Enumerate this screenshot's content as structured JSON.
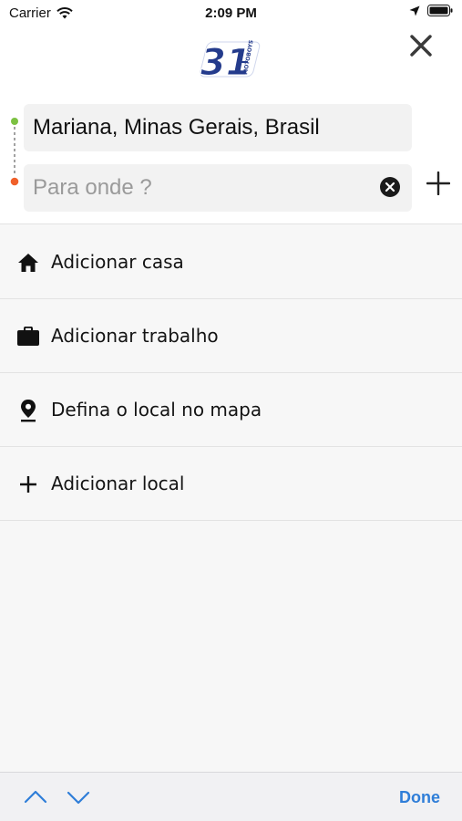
{
  "status_bar": {
    "carrier": "Carrier",
    "time": "2:09 PM"
  },
  "header": {
    "logo_text": "31",
    "logo_subtext": "MOTOBOYS",
    "origin_value": "Mariana, Minas Gerais, Brasil",
    "destination_placeholder": "Para onde ?",
    "destination_value": ""
  },
  "menu": {
    "items": [
      {
        "label": "Adicionar casa",
        "icon": "home-icon"
      },
      {
        "label": "Adicionar trabalho",
        "icon": "briefcase-icon"
      },
      {
        "label": "Defina o local no mapa",
        "icon": "map-pin-icon"
      },
      {
        "label": "Adicionar local",
        "icon": "plus-icon"
      }
    ]
  },
  "keyboard_bar": {
    "done_label": "Done"
  },
  "colors": {
    "origin_dot": "#7cc142",
    "destination_dot": "#f0602a",
    "accent": "#2f7ed8",
    "logo_blue": "#243b8c"
  }
}
